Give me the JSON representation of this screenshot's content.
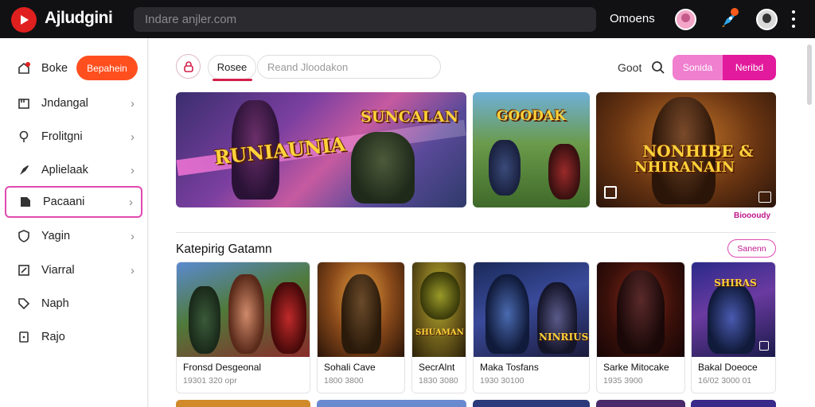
{
  "app": {
    "title": "Ajludgini"
  },
  "search": {
    "placeholder": "Indare anjler.com"
  },
  "topbar": {
    "link": "Omoens",
    "icons": [
      "profile-avatar-icon",
      "rocket-icon",
      "user-avatar-icon",
      "more-vertical-icon"
    ]
  },
  "sidebar": {
    "premium_button": "Bepahein",
    "items": [
      {
        "label": "Boke",
        "icon": "home-icon",
        "chevron": false
      },
      {
        "label": "Jndangal",
        "icon": "library-icon",
        "chevron": true
      },
      {
        "label": "Frolitgni",
        "icon": "pin-icon",
        "chevron": true
      },
      {
        "label": "Aplielaak",
        "icon": "rocket-icon",
        "chevron": true
      },
      {
        "label": "Pacaani",
        "icon": "tag-icon",
        "chevron": true,
        "active": true
      },
      {
        "label": "Yagin",
        "icon": "shield-icon",
        "chevron": true
      },
      {
        "label": "Viarral",
        "icon": "edit-icon",
        "chevron": true
      },
      {
        "label": "Naph",
        "icon": "tag-outline-icon",
        "chevron": false
      },
      {
        "label": "Rajo",
        "icon": "card-icon",
        "chevron": false
      }
    ]
  },
  "toolbar": {
    "tab": "Rosee",
    "filter_placeholder": "Reand Jloodakon",
    "link": "Goot",
    "segment_a": "Sonida",
    "segment_b": "Neribd"
  },
  "banners": [
    {
      "title_a": "SUNCALAN",
      "title_b": "RUNIAUNIA"
    },
    {
      "title_a": "GOODAK"
    },
    {
      "title_a": "NONHIBE &",
      "title_b": "NHIRANAIN"
    }
  ],
  "see_more": "Bioooudy",
  "section": {
    "title": "Katepirig Gatamn",
    "button": "Sanenn"
  },
  "cards": [
    {
      "title": "Fronsd Desgeonal",
      "subtitle": "19301 320 opr",
      "art_text": ""
    },
    {
      "title": "Sohali Cave",
      "subtitle": "1800 3800",
      "art_text": ""
    },
    {
      "title": "SecrAlnt",
      "subtitle": "1830 3080",
      "art_text": "SHUAMAN"
    },
    {
      "title": "Maka Tosfans",
      "subtitle": "1930 30100",
      "art_text": "NINRIUS"
    },
    {
      "title": "Sarke Mitocake",
      "subtitle": "1935 3900",
      "art_text": ""
    },
    {
      "title": "Bakal Doeoce",
      "subtitle": "16/02 3000 01",
      "art_text": "SHIRAS"
    }
  ]
}
